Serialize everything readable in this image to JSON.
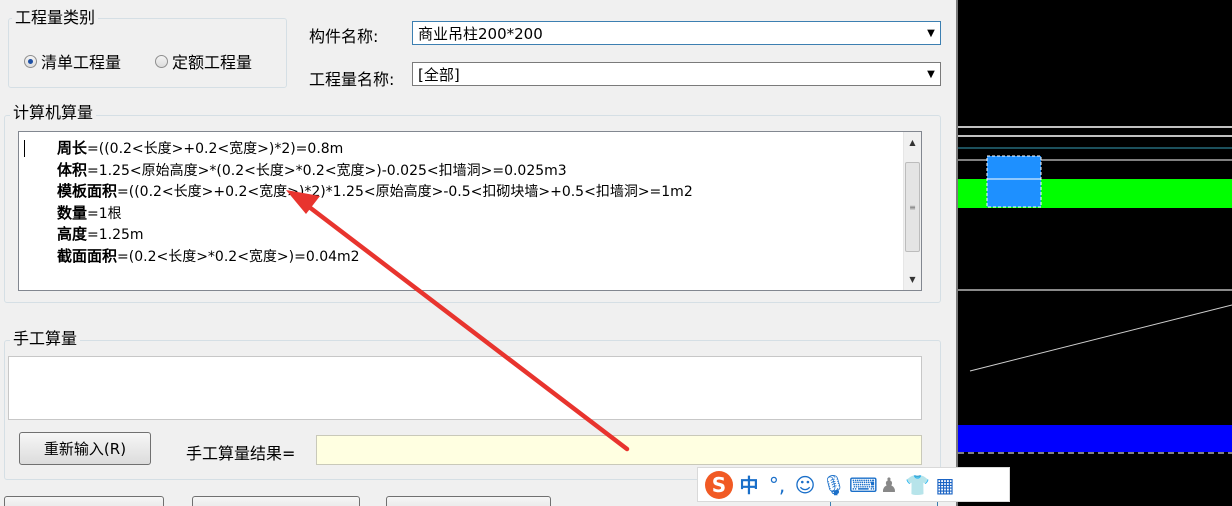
{
  "quantity_type": {
    "title": "工程量类别",
    "options": [
      "清单工程量",
      "定额工程量"
    ],
    "selected": "清单工程量"
  },
  "component": {
    "label": "构件名称:",
    "value": "商业吊柱200*200"
  },
  "quantity_name": {
    "label": "工程量名称:",
    "value": "[全部]"
  },
  "computer_calc": {
    "title": "计算机算量",
    "lines": [
      {
        "name": "周长",
        "formula": "=((0.2<长度>+0.2<宽度>)*2)=0.8m"
      },
      {
        "name": "体积",
        "formula": "=1.25<原始高度>*(0.2<长度>*0.2<宽度>)-0.025<扣墙洞>=0.025m3"
      },
      {
        "name": "模板面积",
        "formula": "=((0.2<长度>+0.2<宽度>)*2)*1.25<原始高度>-0.5<扣砌块墙>+0.5<扣墙洞>=1m2"
      },
      {
        "name": "数量",
        "formula": "=1根"
      },
      {
        "name": "高度",
        "formula": "=1.25m"
      },
      {
        "name": "截面面积",
        "formula": "=(0.2<长度>*0.2<宽度>)=0.04m2"
      }
    ]
  },
  "manual_calc": {
    "title": "手工算量",
    "reenter_button": "重新输入(R)",
    "result_label": "手工算量结果=",
    "result_value": ""
  },
  "ime": {
    "mode": "中"
  },
  "colors": {
    "green_band": "#00ff00",
    "blue_band": "#0000ff",
    "selected_block": "#1e90ff",
    "arrow": "#e8342e"
  }
}
